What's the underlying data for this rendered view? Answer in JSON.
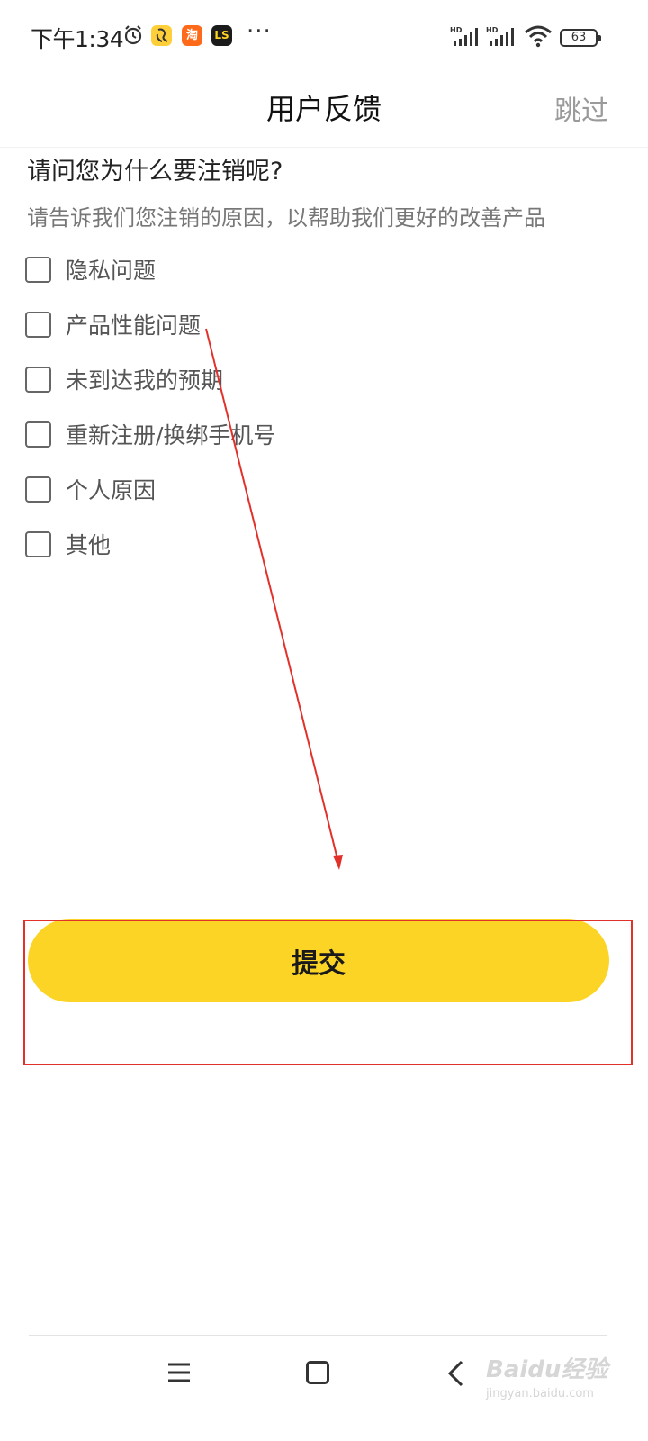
{
  "status_bar": {
    "time": "下午1:34",
    "alarm_icon": "alarm-icon",
    "apps": [
      "淘",
      "LS"
    ],
    "more": "···",
    "signal_label": "HD",
    "battery": "63"
  },
  "header": {
    "title": "用户反馈",
    "skip_label": "跳过"
  },
  "content": {
    "question": "请问您为什么要注销呢?",
    "subtitle": "请告诉我们您注销的原因，以帮助我们更好的改善产品",
    "options": [
      {
        "label": "隐私问题",
        "checked": false
      },
      {
        "label": "产品性能问题",
        "checked": false
      },
      {
        "label": "未到达我的预期",
        "checked": false
      },
      {
        "label": "重新注册/换绑手机号",
        "checked": false
      },
      {
        "label": "个人原因",
        "checked": false
      },
      {
        "label": "其他",
        "checked": false
      }
    ]
  },
  "submit": {
    "label": "提交",
    "color": "#fcd426"
  },
  "annotation": {
    "color": "#e2302a"
  },
  "nav_bar": {
    "icons": [
      "menu-icon",
      "home-icon",
      "back-icon"
    ]
  },
  "watermark": {
    "main": "Baidu经验",
    "sub": "jingyan.baidu.com"
  }
}
